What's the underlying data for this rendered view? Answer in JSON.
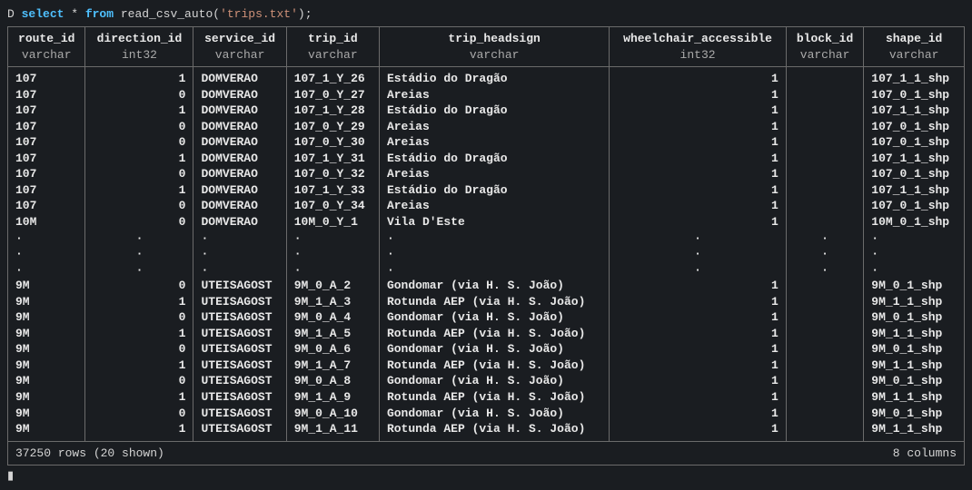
{
  "prompt": {
    "prefix": "D ",
    "select": "select",
    "star": " * ",
    "from": "from",
    "func": " read_csv_auto(",
    "arg": "'trips.txt'",
    "close": ");"
  },
  "columns": [
    {
      "name": "route_id",
      "type": "varchar",
      "align": "left"
    },
    {
      "name": "direction_id",
      "type": "int32",
      "align": "right"
    },
    {
      "name": "service_id",
      "type": "varchar",
      "align": "left"
    },
    {
      "name": "trip_id",
      "type": "varchar",
      "align": "left"
    },
    {
      "name": "trip_headsign",
      "type": "varchar",
      "align": "left"
    },
    {
      "name": "wheelchair_accessible",
      "type": "int32",
      "align": "right"
    },
    {
      "name": "block_id",
      "type": "varchar",
      "align": "left"
    },
    {
      "name": "shape_id",
      "type": "varchar",
      "align": "left"
    }
  ],
  "rows": [
    [
      "107",
      "1",
      "DOMVERAO",
      "107_1_Y_26",
      "Estádio do Dragão",
      "1",
      "",
      "107_1_1_shp"
    ],
    [
      "107",
      "0",
      "DOMVERAO",
      "107_0_Y_27",
      "Areias",
      "1",
      "",
      "107_0_1_shp"
    ],
    [
      "107",
      "1",
      "DOMVERAO",
      "107_1_Y_28",
      "Estádio do Dragão",
      "1",
      "",
      "107_1_1_shp"
    ],
    [
      "107",
      "0",
      "DOMVERAO",
      "107_0_Y_29",
      "Areias",
      "1",
      "",
      "107_0_1_shp"
    ],
    [
      "107",
      "0",
      "DOMVERAO",
      "107_0_Y_30",
      "Areias",
      "1",
      "",
      "107_0_1_shp"
    ],
    [
      "107",
      "1",
      "DOMVERAO",
      "107_1_Y_31",
      "Estádio do Dragão",
      "1",
      "",
      "107_1_1_shp"
    ],
    [
      "107",
      "0",
      "DOMVERAO",
      "107_0_Y_32",
      "Areias",
      "1",
      "",
      "107_0_1_shp"
    ],
    [
      "107",
      "1",
      "DOMVERAO",
      "107_1_Y_33",
      "Estádio do Dragão",
      "1",
      "",
      "107_1_1_shp"
    ],
    [
      "107",
      "0",
      "DOMVERAO",
      "107_0_Y_34",
      "Areias",
      "1",
      "",
      "107_0_1_shp"
    ],
    [
      "10M",
      "0",
      "DOMVERAO",
      "10M_0_Y_1",
      "Vila D'Este",
      "1",
      "",
      "10M_0_1_shp"
    ],
    [
      " ·",
      "·",
      "·",
      "·",
      "·",
      "·",
      "·",
      "·"
    ],
    [
      " ·",
      "·",
      "·",
      "·",
      "·",
      "·",
      "·",
      "·"
    ],
    [
      " ·",
      "·",
      "·",
      "·",
      "·",
      "·",
      "·",
      "·"
    ],
    [
      "9M",
      "0",
      "UTEISAGOST",
      "9M_0_A_2",
      "Gondomar (via H. S. João)",
      "1",
      "",
      "9M_0_1_shp"
    ],
    [
      "9M",
      "1",
      "UTEISAGOST",
      "9M_1_A_3",
      "Rotunda AEP (via H. S. João)",
      "1",
      "",
      "9M_1_1_shp"
    ],
    [
      "9M",
      "0",
      "UTEISAGOST",
      "9M_0_A_4",
      "Gondomar (via H. S. João)",
      "1",
      "",
      "9M_0_1_shp"
    ],
    [
      "9M",
      "1",
      "UTEISAGOST",
      "9M_1_A_5",
      "Rotunda AEP (via H. S. João)",
      "1",
      "",
      "9M_1_1_shp"
    ],
    [
      "9M",
      "0",
      "UTEISAGOST",
      "9M_0_A_6",
      "Gondomar (via H. S. João)",
      "1",
      "",
      "9M_0_1_shp"
    ],
    [
      "9M",
      "1",
      "UTEISAGOST",
      "9M_1_A_7",
      "Rotunda AEP (via H. S. João)",
      "1",
      "",
      "9M_1_1_shp"
    ],
    [
      "9M",
      "0",
      "UTEISAGOST",
      "9M_0_A_8",
      "Gondomar (via H. S. João)",
      "1",
      "",
      "9M_0_1_shp"
    ],
    [
      "9M",
      "1",
      "UTEISAGOST",
      "9M_1_A_9",
      "Rotunda AEP (via H. S. João)",
      "1",
      "",
      "9M_1_1_shp"
    ],
    [
      "9M",
      "0",
      "UTEISAGOST",
      "9M_0_A_10",
      "Gondomar (via H. S. João)",
      "1",
      "",
      "9M_0_1_shp"
    ],
    [
      "9M",
      "1",
      "UTEISAGOST",
      "9M_1_A_11",
      "Rotunda AEP (via H. S. João)",
      "1",
      "",
      "9M_1_1_shp"
    ]
  ],
  "ellipsis_row_indices": [
    10,
    11,
    12
  ],
  "footer": {
    "left": "37250 rows (20 shown)",
    "right": "8 columns"
  },
  "cursor": "▮"
}
